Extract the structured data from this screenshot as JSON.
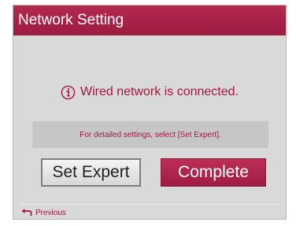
{
  "dialog": {
    "title": "Network Setting",
    "status_icon": "info-icon",
    "status_text": "Wired network is connected.",
    "hint_text": "For detailed settings, select [Set Expert].",
    "buttons": {
      "set_expert": "Set Expert",
      "complete": "Complete"
    },
    "footer": {
      "previous_icon": "back-arrow-icon",
      "previous_label": "Previous"
    }
  },
  "colors": {
    "accent": "#a3163f",
    "title_bar": "#a82246",
    "panel": "#d9d9d9",
    "hint_box": "#c6c6c6"
  }
}
